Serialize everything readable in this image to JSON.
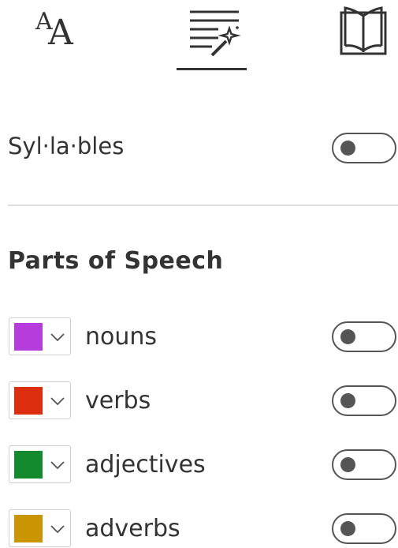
{
  "tabs": [
    {
      "id": "text-options",
      "icon": "text-size-icon",
      "glyph_small": "A",
      "glyph_large": "A",
      "selected": false
    },
    {
      "id": "grammar-options",
      "icon": "grammar-magic-wand-icon",
      "selected": true
    },
    {
      "id": "reading-preferences",
      "icon": "open-book-icon",
      "selected": false
    }
  ],
  "syllables": {
    "label": "Syl·la·bles",
    "on": false
  },
  "parts_of_speech": {
    "title": "Parts of Speech",
    "items": [
      {
        "label": "nouns",
        "color": "#b43ddb",
        "on": false
      },
      {
        "label": "verbs",
        "color": "#dd2f10",
        "on": false
      },
      {
        "label": "adjectives",
        "color": "#128a2d",
        "on": false
      },
      {
        "label": "adverbs",
        "color": "#c99500",
        "on": false
      }
    ]
  },
  "colors": {
    "text": "#333333",
    "divider": "#dedede",
    "toggle": "#555555"
  }
}
